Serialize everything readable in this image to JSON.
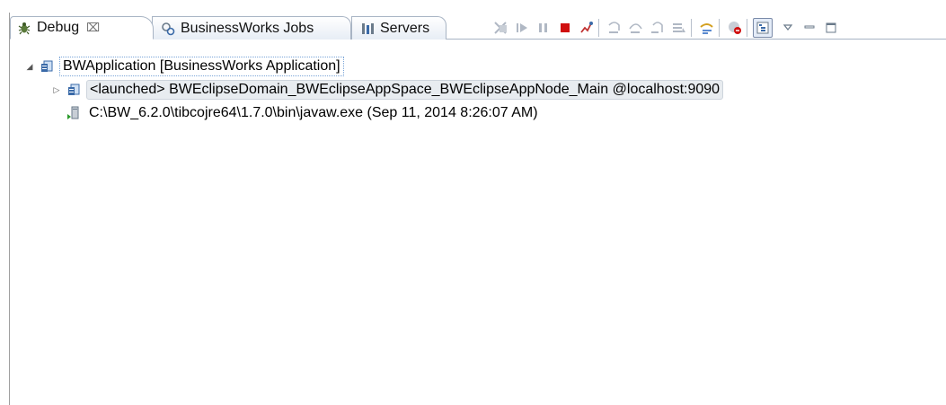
{
  "tabs": [
    {
      "label": "Debug",
      "close": "⌧",
      "icon": "debug-bug-icon",
      "active": true
    },
    {
      "label": "BusinessWorks Jobs",
      "icon": "jobs-gears-icon",
      "active": false
    },
    {
      "label": "Servers",
      "icon": "servers-icon",
      "active": false
    }
  ],
  "toolbar": {
    "buttons": [
      "remove-launches-icon",
      "resume-icon",
      "suspend-icon",
      "terminate-icon",
      "disconnect-icon",
      "step-into-icon",
      "step-over-icon",
      "step-return-icon",
      "drop-to-frame-icon",
      "use-step-filters-icon",
      "skip-breakpoints-icon",
      "show-debug-view-icon"
    ]
  },
  "tree": {
    "root": {
      "label": "BWApplication [BusinessWorks Application]",
      "icon": "bw-application-icon"
    },
    "child": {
      "label": "<launched> BWEclipseDomain_BWEclipseAppSpace_BWEclipseAppNode_Main @localhost:9090",
      "icon": "bw-node-icon"
    },
    "process": {
      "label": "C:\\BW_6.2.0\\tibcojre64\\1.7.0\\bin\\javaw.exe (Sep 11, 2014 8:26:07 AM)",
      "icon": "process-icon"
    }
  },
  "colors": {
    "tab_border": "#a8b4c4",
    "terminate_red": "#d01010",
    "selection_bg": "#e8ecf0"
  }
}
